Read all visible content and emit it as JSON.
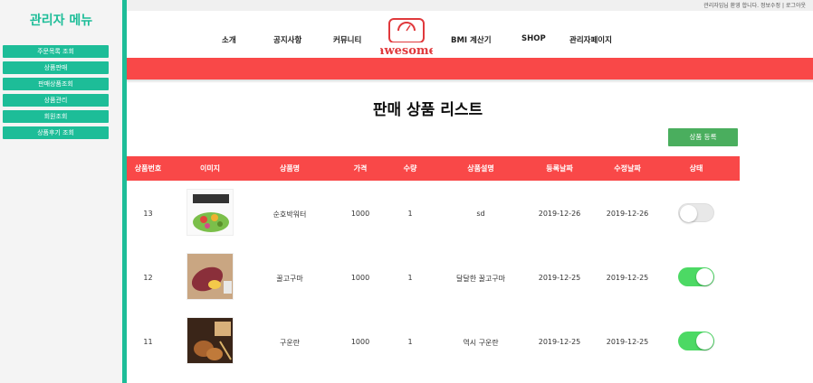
{
  "sidebar": {
    "title": "관리자 메뉴",
    "items": [
      {
        "label": "주문목록 조회"
      },
      {
        "label": "상품판매"
      },
      {
        "label": "판매상품조회"
      },
      {
        "label": "상품관리"
      },
      {
        "label": "회원조회"
      },
      {
        "label": "상품후기 조회"
      }
    ]
  },
  "topbar": {
    "text": "관리자임님 환영 합니다. 정보수정 | 로그아웃"
  },
  "nav": {
    "items": [
      "소개",
      "공지사항",
      "커뮤니티",
      "BMI 계산기",
      "SHOP",
      "관리자페이지"
    ],
    "logo_text": "awesome"
  },
  "page": {
    "title": "판매 상품 리스트",
    "add_button": "상품 등록"
  },
  "table": {
    "headers": [
      "상품번호",
      "이미지",
      "상품명",
      "가격",
      "수량",
      "상품설명",
      "등록날짜",
      "수정날짜",
      "상태"
    ],
    "rows": [
      {
        "id": "13",
        "image_icon": "salad-image",
        "name": "순호박워터",
        "price": "1000",
        "qty": "1",
        "desc": "sd",
        "reg": "2019-12-26",
        "mod": "2019-12-26",
        "status_on": false
      },
      {
        "id": "12",
        "image_icon": "sweet-potato-image",
        "name": "꿀고구마",
        "price": "1000",
        "qty": "1",
        "desc": "달달한 꿀고구마",
        "reg": "2019-12-25",
        "mod": "2019-12-25",
        "status_on": true
      },
      {
        "id": "11",
        "image_icon": "roasted-egg-image",
        "name": "구운란",
        "price": "1000",
        "qty": "1",
        "desc": "역시 구운란",
        "reg": "2019-12-25",
        "mod": "2019-12-25",
        "status_on": true
      }
    ]
  },
  "colors": {
    "accent": "#1dbd98",
    "red": "#f94848",
    "green": "#4aae5e",
    "toggle_on": "#4cd964"
  }
}
